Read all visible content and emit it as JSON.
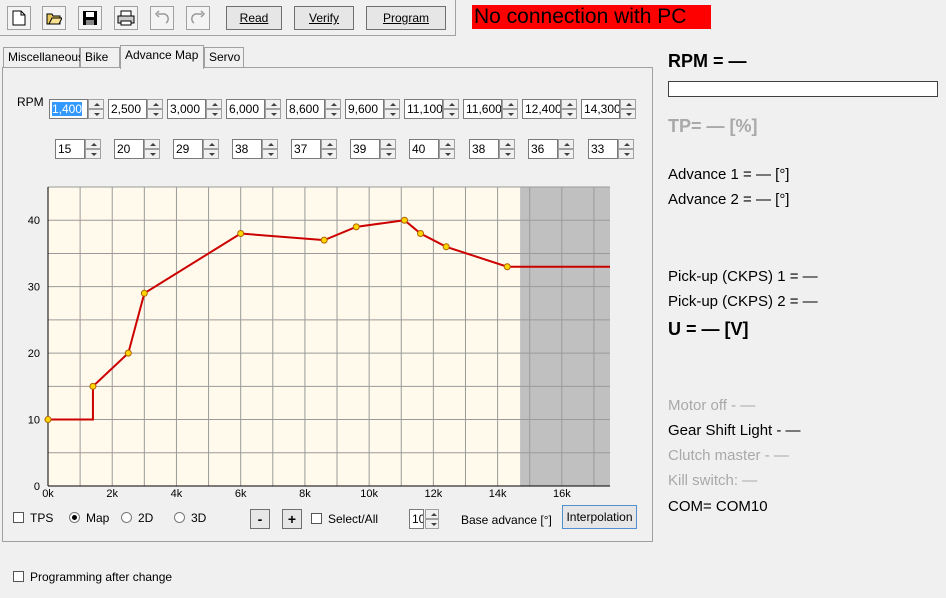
{
  "toolbar": {
    "icons": [
      "new-file-icon",
      "open-folder-icon",
      "save-icon",
      "print-icon",
      "undo-icon",
      "redo-icon"
    ],
    "read_label": "Read",
    "verify_label": "Verify",
    "program_label": "Program"
  },
  "status": {
    "no_connection": "No connection with PC",
    "color": "#ff0000"
  },
  "tabs": [
    {
      "label": "Miscellaneous"
    },
    {
      "label": "Bike"
    },
    {
      "label": "Advance Map",
      "active": true
    },
    {
      "label": "Servo"
    }
  ],
  "map": {
    "rpm_label": "RPM",
    "rpm_values": [
      "1,400",
      "2,500",
      "3,000",
      "6,000",
      "8,600",
      "9,600",
      "11,100",
      "11,600",
      "12,400",
      "14,300"
    ],
    "advance_values": [
      "15",
      "20",
      "29",
      "38",
      "37",
      "39",
      "40",
      "38",
      "36",
      "33"
    ]
  },
  "chart_data": {
    "type": "line",
    "x": [
      0,
      1400,
      1400,
      2500,
      3000,
      6000,
      8600,
      9600,
      11100,
      11600,
      12400,
      14300,
      17500
    ],
    "y": [
      10,
      10,
      15,
      20,
      29,
      38,
      37,
      39,
      40,
      38,
      36,
      33,
      33
    ],
    "points": [
      [
        0,
        10
      ],
      [
        1400,
        15
      ],
      [
        2500,
        20
      ],
      [
        3000,
        29
      ],
      [
        6000,
        38
      ],
      [
        8600,
        37
      ],
      [
        9600,
        39
      ],
      [
        11100,
        40
      ],
      [
        11600,
        38
      ],
      [
        12400,
        36
      ],
      [
        14300,
        33
      ]
    ],
    "xlim": [
      0,
      17500
    ],
    "ylim": [
      0,
      45
    ],
    "x_ticks": [
      "0k",
      "2k",
      "4k",
      "6k",
      "8k",
      "10k",
      "12k",
      "14k",
      "16k"
    ],
    "x_tick_values": [
      0,
      2000,
      4000,
      6000,
      8000,
      10000,
      12000,
      14000,
      16000
    ],
    "y_ticks": [
      "0",
      "10",
      "20",
      "30",
      "40"
    ],
    "y_tick_values": [
      0,
      10,
      20,
      30,
      40
    ],
    "shaded_from_x": 14700,
    "grid": true,
    "line_color": "#cc0000",
    "point_color": "#ffd700",
    "background_color": "#fffaeb",
    "shade_color": "#c0c0c0"
  },
  "bottom": {
    "tps_label": "TPS",
    "map_label": "Map",
    "mode_2d_label": "2D",
    "mode_3d_label": "3D",
    "minus_label": "-",
    "plus_label": "+",
    "select_all_label": "Select/All",
    "base_advance_value": "10",
    "base_advance_label": "Base advance [°]",
    "interpolation_label": "Interpolation",
    "programming_after_change": "Programming after change"
  },
  "readouts": {
    "rpm": "RPM = —",
    "rpm_level": 0,
    "tp": "TP= — [%]",
    "advance1": "Advance 1 = — [°]",
    "advance2": "Advance 2 = — [°]",
    "pickup1": "Pick-up (CKPS) 1 = —",
    "pickup2": "Pick-up (CKPS) 2 = —",
    "voltage": "U = — [V]",
    "motor_off": "Motor off - —",
    "gear_shift": "Gear Shift Light - —",
    "clutch": "Clutch master - —",
    "kill_switch": "Kill switch: —",
    "com": "COM= COM10"
  }
}
